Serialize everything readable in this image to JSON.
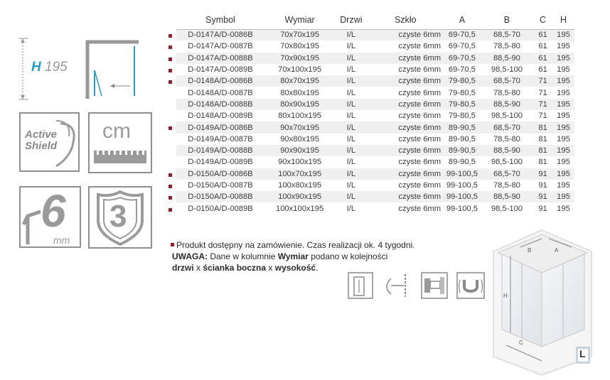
{
  "icons": {
    "height_label": "H",
    "height_value": "195",
    "shield_line1": "Active",
    "shield_line2": "Shield",
    "cm_label": "cm",
    "glass_number": "6",
    "glass_unit": "mm",
    "warranty_number": "3"
  },
  "table": {
    "headers": [
      "Symbol",
      "Wymiar",
      "Drzwi",
      "Szkło",
      "A",
      "B",
      "C",
      "H"
    ],
    "rows": [
      {
        "symbol": "D-0147A/D-0086B",
        "wymiar": "70x70x195",
        "drzwi": "I/L",
        "szklo": "czyste 6mm",
        "a": "69-70,5",
        "b": "68,5-70",
        "c": "61",
        "h": "195",
        "marked": true
      },
      {
        "symbol": "D-0147A/D-0087B",
        "wymiar": "70x80x195",
        "drzwi": "I/L",
        "szklo": "czyste 6mm",
        "a": "69-70,5",
        "b": "78,5-80",
        "c": "61",
        "h": "195",
        "marked": true
      },
      {
        "symbol": "D-0147A/D-0088B",
        "wymiar": "70x90x195",
        "drzwi": "I/L",
        "szklo": "czyste 6mm",
        "a": "69-70,5",
        "b": "88,5-90",
        "c": "61",
        "h": "195",
        "marked": true
      },
      {
        "symbol": "D-0147A/D-0089B",
        "wymiar": "70x100x195",
        "drzwi": "I/L",
        "szklo": "czyste 6mm",
        "a": "69-70,5",
        "b": "98,5-100",
        "c": "61",
        "h": "195",
        "marked": true
      },
      {
        "symbol": "D-0148A/D-0086B",
        "wymiar": "80x70x195",
        "drzwi": "I/L",
        "szklo": "czyste 6mm",
        "a": "79-80,5",
        "b": "68,5-70",
        "c": "71",
        "h": "195",
        "marked": true
      },
      {
        "symbol": "D-0148A/D-0087B",
        "wymiar": "80x80x195",
        "drzwi": "I/L",
        "szklo": "czyste 6mm",
        "a": "79-80,5",
        "b": "78,5-80",
        "c": "71",
        "h": "195",
        "marked": false
      },
      {
        "symbol": "D-0148A/D-0088B",
        "wymiar": "80x90x195",
        "drzwi": "I/L",
        "szklo": "czyste 6mm",
        "a": "79-80,5",
        "b": "88,5-90",
        "c": "71",
        "h": "195",
        "marked": false
      },
      {
        "symbol": "D-0148A/D-0089B",
        "wymiar": "80x100x195",
        "drzwi": "I/L",
        "szklo": "czyste 6mm",
        "a": "79-80,5",
        "b": "98,5-100",
        "c": "71",
        "h": "195",
        "marked": false
      },
      {
        "symbol": "D-0149A/D-0086B",
        "wymiar": "90x70x195",
        "drzwi": "I/L",
        "szklo": "czyste 6mm",
        "a": "89-90,5",
        "b": "68,5-70",
        "c": "81",
        "h": "195",
        "marked": true
      },
      {
        "symbol": "D-0149A/D-0087B",
        "wymiar": "90x80x195",
        "drzwi": "I/L",
        "szklo": "czyste 6mm",
        "a": "89-90,5",
        "b": "78,5-80",
        "c": "81",
        "h": "195",
        "marked": false
      },
      {
        "symbol": "D-0149A/D-0088B",
        "wymiar": "90x90x195",
        "drzwi": "I/L",
        "szklo": "czyste 6mm",
        "a": "89-90,5",
        "b": "88,5-90",
        "c": "81",
        "h": "195",
        "marked": false
      },
      {
        "symbol": "D-0149A/D-0089B",
        "wymiar": "90x100x195",
        "drzwi": "I/L",
        "szklo": "czyste 6mm",
        "a": "89-90,5",
        "b": "98,5-100",
        "c": "81",
        "h": "195",
        "marked": false
      },
      {
        "symbol": "D-0150A/D-0086B",
        "wymiar": "100x70x195",
        "drzwi": "I/L",
        "szklo": "czyste 6mm",
        "a": "99-100,5",
        "b": "68,5-70",
        "c": "91",
        "h": "195",
        "marked": true
      },
      {
        "symbol": "D-0150A/D-0087B",
        "wymiar": "100x80x195",
        "drzwi": "I/L",
        "szklo": "czyste 6mm",
        "a": "99-100,5",
        "b": "78,5-80",
        "c": "91",
        "h": "195",
        "marked": true
      },
      {
        "symbol": "D-0150A/D-0088B",
        "wymiar": "100x90x195",
        "drzwi": "I/L",
        "szklo": "czyste 6mm",
        "a": "99-100,5",
        "b": "88,5-90",
        "c": "91",
        "h": "195",
        "marked": true
      },
      {
        "symbol": "D-0150A/D-0089B",
        "wymiar": "100x100x195",
        "drzwi": "I/L",
        "szklo": "czyste 6mm",
        "a": "99-100,5",
        "b": "98,5-100",
        "c": "91",
        "h": "195",
        "marked": true
      }
    ]
  },
  "notes": {
    "availability": "Produkt dostępny na zamówienie. Czas realizacji ok. 4 tygodni.",
    "warning_label": "UWAGA:",
    "warning_text_1": " Dane w kolumnie ",
    "warning_column": "Wymiar",
    "warning_text_2": " podano w kolejności",
    "order_1": "drzwi",
    "x1": " x ",
    "order_2": "ścianka boczna",
    "x2": " x ",
    "order_3": "wysokość",
    "dot": "."
  },
  "diagram": {
    "label_a": "A",
    "label_b": "B",
    "label_c": "C",
    "label_h": "H",
    "badge": "L"
  },
  "colors": {
    "bullet": "#8b1f2f",
    "accent_blue": "#2a9cc1",
    "tile_grey": "#8f8f8f"
  }
}
